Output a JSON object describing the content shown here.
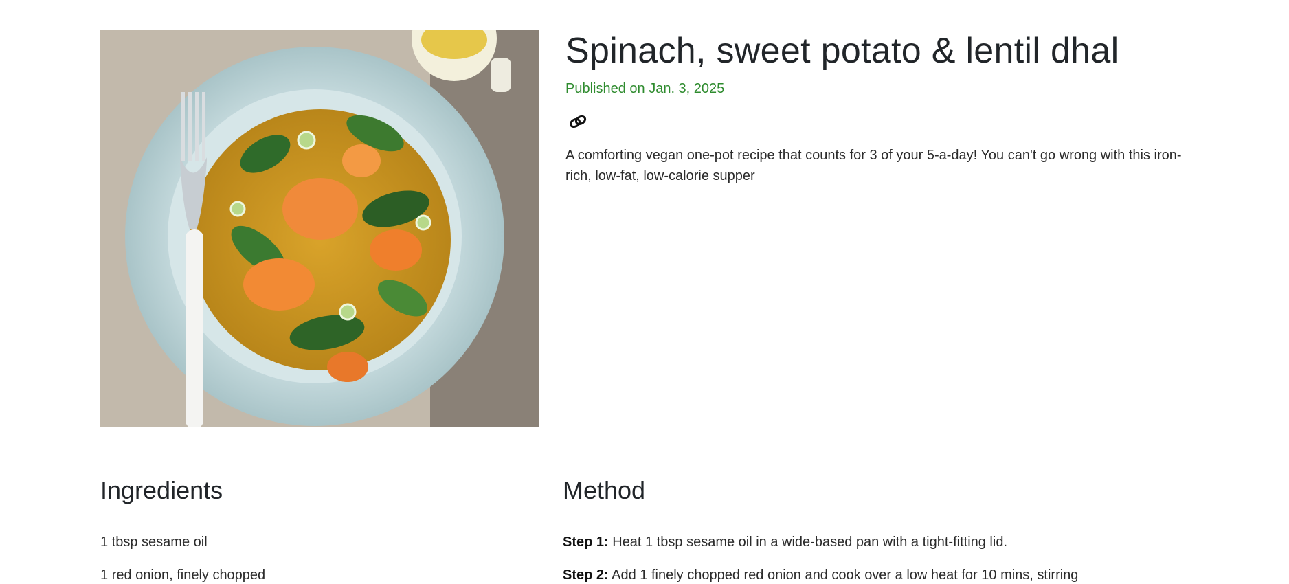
{
  "recipe": {
    "title": "Spinach, sweet potato & lentil dhal",
    "published": "Published on Jan. 3, 2025",
    "description": "A comforting vegan one-pot recipe that counts for 3 of your 5-a-day! You can't go wrong with this iron-rich, low-fat, low-calorie supper",
    "link_icon": "link-icon"
  },
  "ingredients": {
    "heading": "Ingredients",
    "items": [
      "1 tbsp sesame oil",
      "1 red onion, finely chopped"
    ]
  },
  "method": {
    "heading": "Method",
    "steps": [
      {
        "label": "Step 1:",
        "text": " Heat 1 tbsp sesame oil in a wide-based pan with a tight-fitting lid."
      },
      {
        "label": "Step 2:",
        "text": " Add 1 finely chopped red onion and cook over a low heat for 10 mins, stirring"
      }
    ]
  },
  "colors": {
    "published": "#2e8b2e",
    "text": "#212529"
  }
}
